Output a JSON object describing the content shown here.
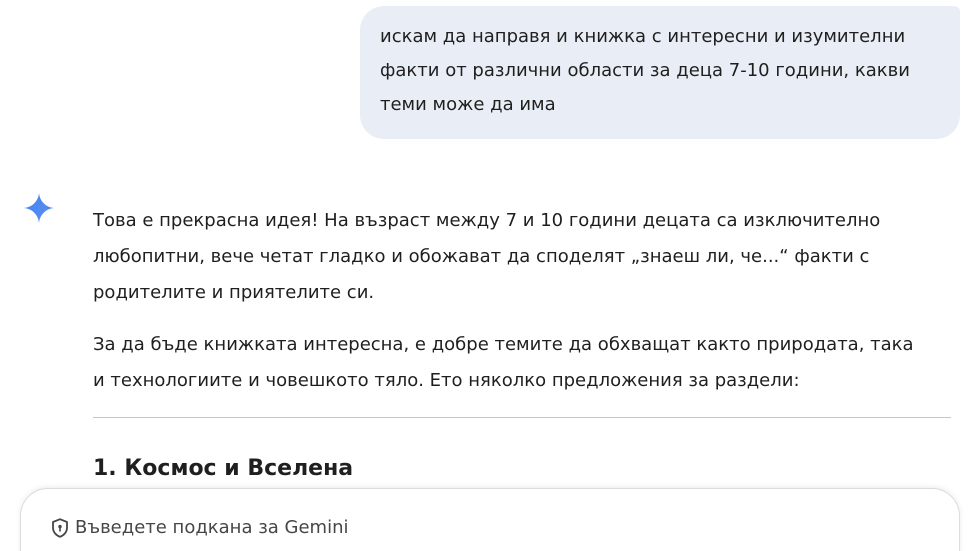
{
  "conversation": {
    "user_message": {
      "line1": "искам да направя и книжка с интересни и изумителни",
      "line2": "факти от различни области за деца 7-10 години, какви",
      "line3": "теми може да има"
    },
    "response": {
      "icon": "gemini-sparkle-icon",
      "paragraph1": {
        "line1": "Това е прекрасна идея! На възраст между 7 и 10 години децата са изключително",
        "line2": "любопитни, вече четат гладко и обожават да споделят „знаеш ли, че...“ факти с",
        "line3": "родителите и приятелите си."
      },
      "paragraph2": {
        "line1": "За да бъде книжката интересна, е добре темите да обхващат както природата, така",
        "line2": "и технологиите и човешкото тяло. Ето няколко предложения за раздели:"
      },
      "section1_heading": "1. Космос и Вселена"
    }
  },
  "prompt_input": {
    "placeholder": "Въведете подкана за Gemini",
    "icon": "shield-icon"
  },
  "colors": {
    "user_bubble_bg": "#e9eef6",
    "gemini_gradient_start": "#4285f4",
    "gemini_gradient_end": "#9b72cb",
    "text": "#1f1f1f",
    "divider": "#c4c7c5"
  }
}
